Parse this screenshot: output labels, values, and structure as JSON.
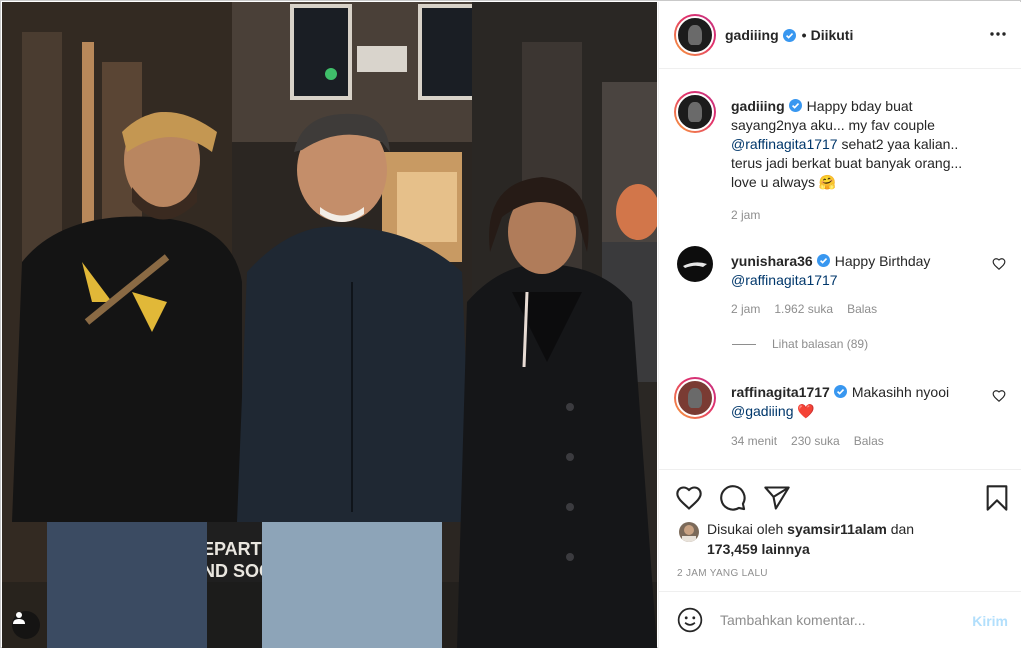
{
  "post": {
    "author": "gadiiing",
    "follow_state": "Diikuti",
    "separator": "•",
    "caption": {
      "username": "gadiiing",
      "text_before_mention": "Happy bday buat sayang2nya aku... my fav couple",
      "mention": "@raffinagita1717",
      "text_after_mention": "sehat2 yaa kalian.. terus jadi berkat buat banyak orang... love u always 🤗",
      "time": "2 jam"
    },
    "comments": [
      {
        "username": "yunishara36",
        "text": "Happy Birthday",
        "mention": "@raffinagita1717",
        "time": "2 jam",
        "likes": "1.962 suka",
        "reply": "Balas",
        "view_replies": "Lihat balasan (89)"
      },
      {
        "username": "raffinagita1717",
        "text": "Makasihh nyooi",
        "mention": "@gadiiing",
        "emoji": "❤️",
        "time": "34 menit",
        "likes": "230 suka",
        "reply": "Balas"
      }
    ],
    "liked_by": {
      "prefix": "Disukai oleh",
      "user": "syamsir11alam",
      "connector": "dan",
      "others": "173,459 lainnya"
    },
    "time_ago": "2 JAM YANG LALU",
    "comment_box": {
      "placeholder": "Tambahkan komentar...",
      "post_label": "Kirim"
    },
    "photo": {
      "sign_text_1": "EPARTI",
      "sign_text_2": "ND SOC"
    }
  },
  "colors": {
    "verified": "#3897f0",
    "mention": "#00376b",
    "heart_red": "#ed4956",
    "post_disabled": "#b2dffc"
  },
  "icons": [
    "heart-icon",
    "comment-icon",
    "share-icon",
    "bookmark-icon",
    "more-icon",
    "emoji-icon",
    "user-tag-icon",
    "verified-badge-icon"
  ]
}
